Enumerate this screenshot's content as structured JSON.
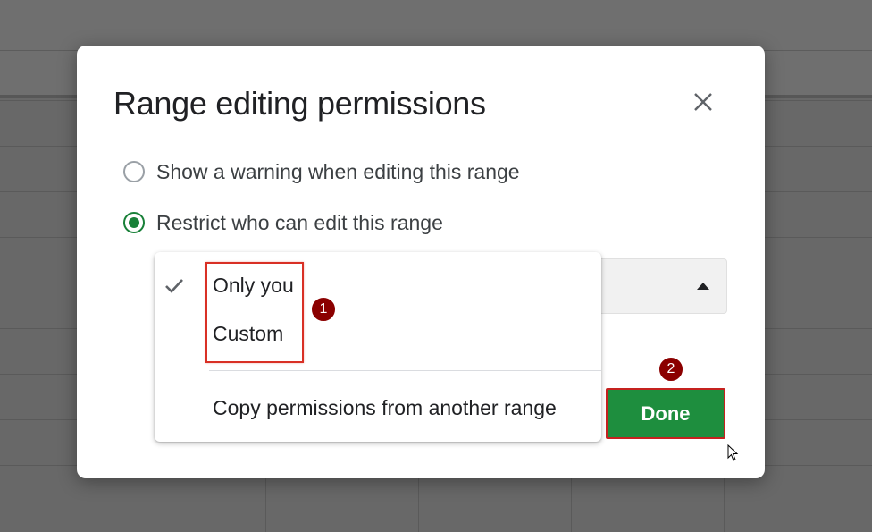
{
  "dialog": {
    "title": "Range editing permissions",
    "close_icon": "close-icon"
  },
  "options": [
    {
      "label": "Show a warning when editing this range",
      "selected": false
    },
    {
      "label": "Restrict who can edit this range",
      "selected": true
    }
  ],
  "dropdown": {
    "items": [
      "Only you",
      "Custom",
      "Copy permissions from another range"
    ],
    "checked_item": "Only you",
    "check_icon": "check-icon"
  },
  "done_button": {
    "label": "Done"
  },
  "annotations": {
    "badge_1": "1",
    "badge_2": "2"
  },
  "colors": {
    "accent_green": "#1e8e3e",
    "highlight_red": "#d93025",
    "badge_dark_red": "#8b0000"
  }
}
